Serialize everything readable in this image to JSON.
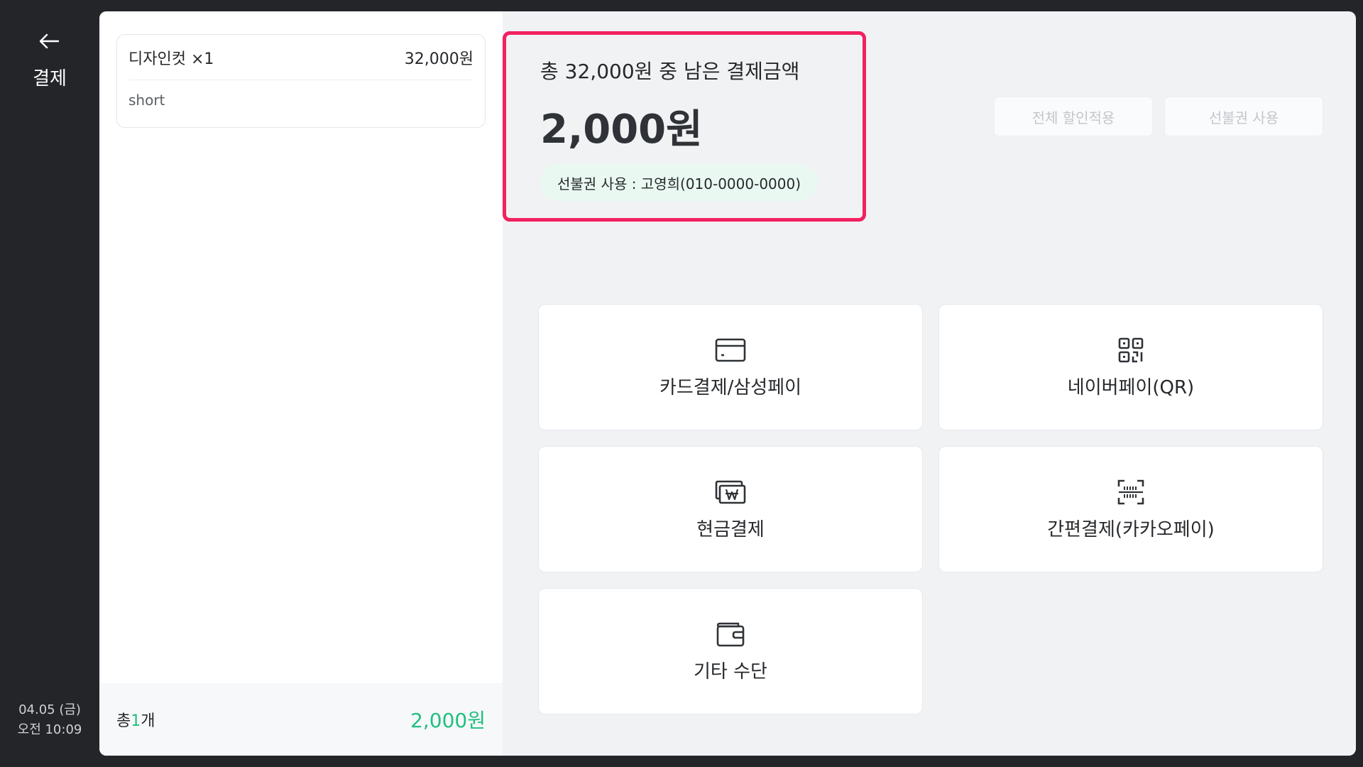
{
  "rail": {
    "title": "결제",
    "date": "04.05 (금)",
    "time": "오전 10:09"
  },
  "order": {
    "item_name": "디자인컷 ×1",
    "item_price": "32,000원",
    "item_option": "short",
    "count_prefix": "총",
    "count_num": "1",
    "count_suffix": "개",
    "total": "2,000원"
  },
  "amount": {
    "label": "총 32,000원 중 남은 결제금액",
    "value": "2,000원",
    "prepaid": "선불권 사용 : 고영희(010-0000-0000)"
  },
  "actions": {
    "discount_all": "전체 할인적용",
    "use_prepaid": "선불권 사용"
  },
  "methods": [
    {
      "label": "카드결제/삼성페이",
      "icon": "card-icon"
    },
    {
      "label": "네이버페이(QR)",
      "icon": "qr-icon"
    },
    {
      "label": "현금결제",
      "icon": "cash-icon"
    },
    {
      "label": "간편결제(카카오페이)",
      "icon": "barcode-scan-icon"
    },
    {
      "label": "기타 수단",
      "icon": "wallet-icon"
    }
  ],
  "colors": {
    "highlight": "#f2215f",
    "accent_green": "#1fbf7f",
    "rail_bg": "#232529"
  }
}
